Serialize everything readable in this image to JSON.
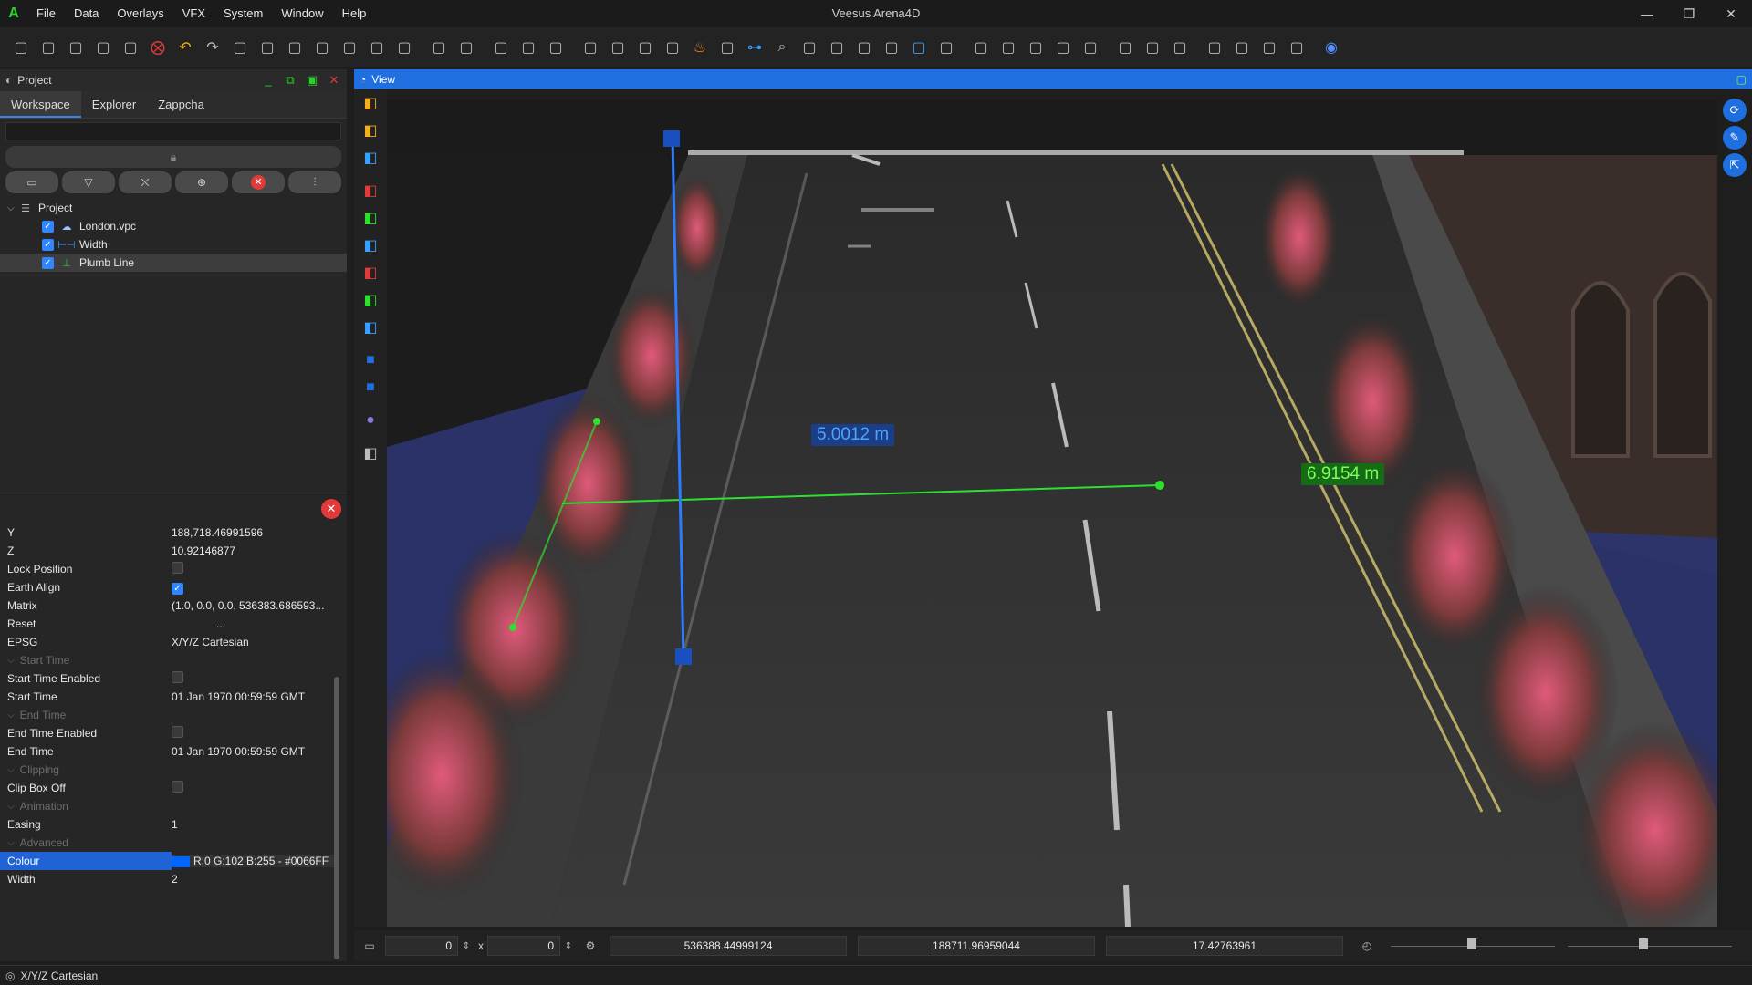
{
  "app": {
    "title": "Veesus Arena4D",
    "logo_letter": "A",
    "menu": [
      "File",
      "Data",
      "Overlays",
      "VFX",
      "System",
      "Window",
      "Help"
    ],
    "window_controls": [
      "—",
      "❐",
      "✕"
    ]
  },
  "project_panel": {
    "title": "Project",
    "tabs": [
      "Workspace",
      "Explorer",
      "Zappcha"
    ],
    "active_tab": "Workspace",
    "search_placeholder": "",
    "tree": {
      "root": "Project",
      "items": [
        {
          "label": "London.vpc",
          "checked": true,
          "icon": "cloud-icon"
        },
        {
          "label": "Width",
          "checked": true,
          "icon": "width-measure-icon"
        },
        {
          "label": "Plumb Line",
          "checked": true,
          "icon": "plumb-line-icon",
          "selected": true
        }
      ]
    }
  },
  "properties": {
    "rows": [
      {
        "type": "row",
        "key": "Y",
        "value": "188,718.46991596"
      },
      {
        "type": "row",
        "key": "Z",
        "value": "10.92146877"
      },
      {
        "type": "check",
        "key": "Lock Position",
        "checked": false
      },
      {
        "type": "check",
        "key": "Earth Align",
        "checked": true
      },
      {
        "type": "row",
        "key": "Matrix",
        "value": "(1.0, 0.0, 0.0, 536383.686593..."
      },
      {
        "type": "row",
        "key": "Reset",
        "value": "..."
      },
      {
        "type": "row",
        "key": "EPSG",
        "value": "X/Y/Z Cartesian"
      },
      {
        "type": "section",
        "key": "Start Time"
      },
      {
        "type": "check",
        "key": "Start Time Enabled",
        "checked": false
      },
      {
        "type": "row",
        "key": "Start Time",
        "value": "01 Jan 1970 00:59:59 GMT"
      },
      {
        "type": "section",
        "key": "End Time"
      },
      {
        "type": "check",
        "key": "End Time Enabled",
        "checked": false
      },
      {
        "type": "row",
        "key": "End Time",
        "value": "01 Jan 1970 00:59:59 GMT"
      },
      {
        "type": "section",
        "key": "Clipping"
      },
      {
        "type": "check",
        "key": "Clip Box Off",
        "checked": false
      },
      {
        "type": "section",
        "key": "Animation"
      },
      {
        "type": "row",
        "key": "Easing",
        "value": "1"
      },
      {
        "type": "section",
        "key": "Advanced"
      },
      {
        "type": "colour",
        "key": "Colour",
        "value": "R:0 G:102 B:255 - #0066FF",
        "swatch": "#0066FF",
        "highlight": true
      },
      {
        "type": "row",
        "key": "Width",
        "value": "2"
      }
    ]
  },
  "view": {
    "title": "View",
    "measurements": {
      "plumb_line": "5.0012 m",
      "width": "6.9154 m"
    }
  },
  "coords": {
    "screen_x": "0",
    "screen_y": "0",
    "times": "x",
    "x": "536388.44999124",
    "y": "188711.96959044",
    "z": "17.42763961"
  },
  "status": {
    "crs": "X/Y/Z Cartesian"
  },
  "colors": {
    "accent": "#1f6fe0",
    "plumb_line": "#2f7bff",
    "width_line": "#2ee02e",
    "close_red": "#e23a3a"
  }
}
